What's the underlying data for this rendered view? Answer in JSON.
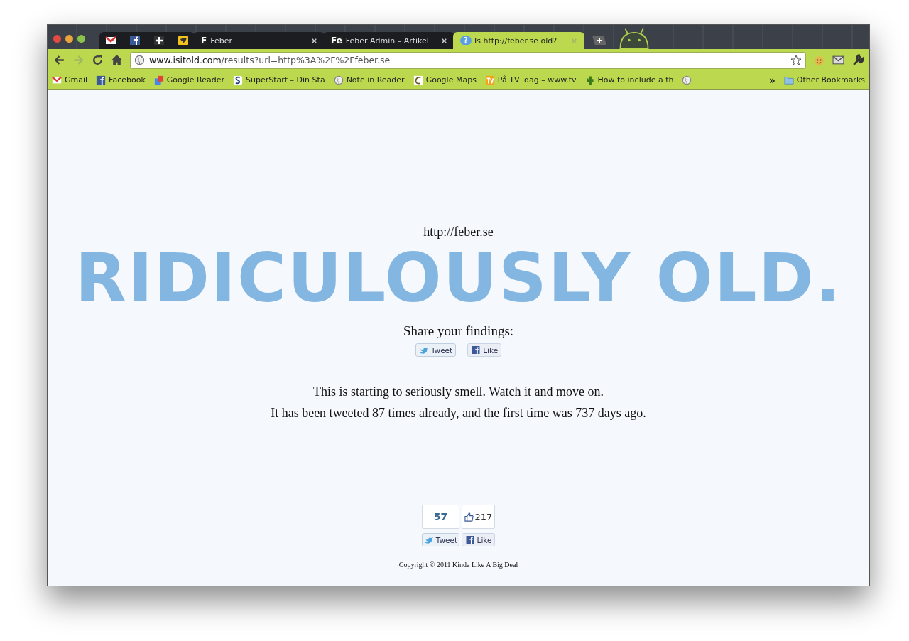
{
  "tabs": [
    {
      "label": "Feber",
      "favicon": "F",
      "selected": false
    },
    {
      "label": "Feber Admin – Artikel",
      "favicon": "Fe",
      "selected": false
    },
    {
      "label": "Is http://feber.se old?",
      "favicon": "?",
      "selected": true
    }
  ],
  "address": {
    "host": "www.isitold.com",
    "path": "/results?url=http%3A%2F%2Ffeber.se"
  },
  "bookmarks": [
    "Gmail",
    "Facebook",
    "Google Reader",
    "SuperStart – Din Sta",
    "Note in Reader",
    "Google Maps",
    "På TV idag – www.tv",
    "How to include a th"
  ],
  "overflow": "»",
  "other_bookmarks": "Other Bookmarks",
  "page": {
    "url": "http://feber.se",
    "verdict": "RIDICULOUSLY OLD.",
    "share_heading": "Share your findings:",
    "tweet": "Tweet",
    "like": "Like",
    "lines": [
      "This is starting to seriously smell. Watch it and move on.",
      "It has been tweeted 87 times already, and the first time was 737 days ago."
    ],
    "tweet_count": "57",
    "like_count": "217",
    "counter_tweet": "Tweet",
    "counter_like": "Like",
    "copyright": "Copyright © 2011 Kinda Like A Big Deal"
  }
}
